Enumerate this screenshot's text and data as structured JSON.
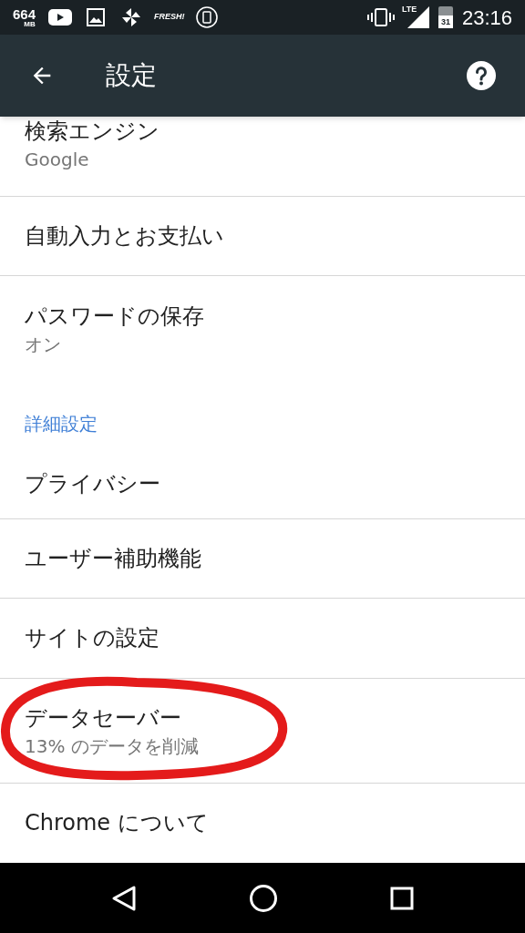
{
  "status_bar": {
    "memory": "664",
    "memory_unit": "MB",
    "app_label": "FRESH!",
    "network": "LTE",
    "calendar_day": "31",
    "time": "23:16"
  },
  "app_bar": {
    "title": "設定"
  },
  "items": [
    {
      "kind": "setting",
      "title": "検索エンジン",
      "subtitle": "Google",
      "divider": true
    },
    {
      "kind": "setting",
      "title": "自動入力とお支払い",
      "divider": true
    },
    {
      "kind": "setting",
      "title": "パスワードの保存",
      "subtitle": "オン",
      "divider": false
    },
    {
      "kind": "header",
      "title": "詳細設定",
      "divider": false
    },
    {
      "kind": "setting",
      "title": "プライバシー",
      "divider": true
    },
    {
      "kind": "setting",
      "title": "ユーザー補助機能",
      "divider": true
    },
    {
      "kind": "setting",
      "title": "サイトの設定",
      "divider": true
    },
    {
      "kind": "setting",
      "title": "データセーバー",
      "subtitle": "13% のデータを削減",
      "divider": true,
      "circled": true
    },
    {
      "kind": "setting",
      "title": "Chrome について",
      "divider": false
    }
  ]
}
